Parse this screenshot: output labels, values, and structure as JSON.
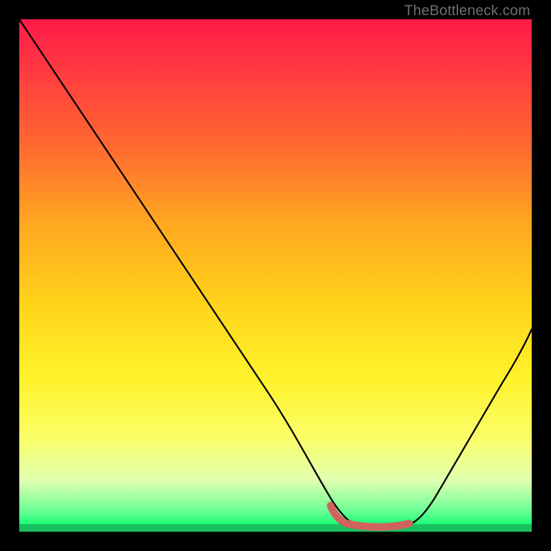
{
  "watermark": "TheBottleneck.com",
  "chart_data": {
    "type": "line",
    "title": "",
    "xlabel": "",
    "ylabel": "",
    "xlim": [
      0,
      100
    ],
    "ylim": [
      0,
      100
    ],
    "grid": false,
    "legend": false,
    "annotations": [],
    "background": {
      "gradient_top_color": "#ff1a49",
      "gradient_mid_color": "#ffe520",
      "gradient_bottom_color": "#18c060",
      "description": "vertical red-to-yellow-to-green gradient indicating bottleneck severity"
    },
    "series": [
      {
        "name": "bottleneck-curve",
        "color": "#000000",
        "x": [
          0,
          6,
          12,
          18,
          24,
          30,
          36,
          42,
          48,
          54,
          59,
          62,
          64,
          67,
          70,
          74,
          78,
          82,
          86,
          90,
          94,
          98,
          100
        ],
        "y": [
          100,
          91,
          82,
          73,
          64,
          55,
          46,
          37,
          28,
          19,
          11,
          6,
          3,
          1,
          0,
          0,
          2,
          6,
          12,
          19,
          27,
          36,
          41
        ]
      },
      {
        "name": "optimal-zone-marker",
        "color": "#d0635e",
        "x": [
          61,
          63,
          66,
          70,
          74,
          76
        ],
        "y": [
          4,
          1.5,
          0.7,
          0.5,
          0.6,
          1.2
        ]
      }
    ]
  }
}
